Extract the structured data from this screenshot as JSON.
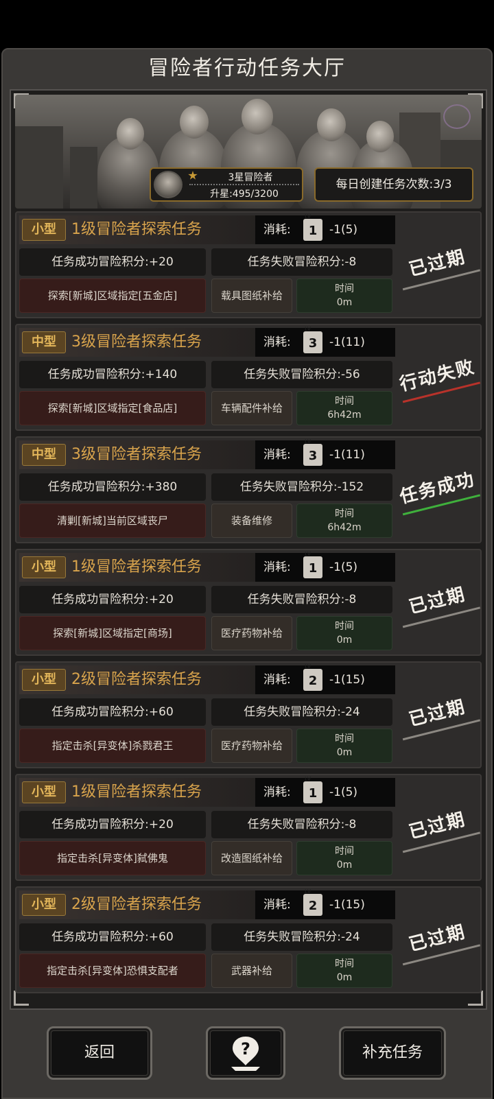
{
  "header": {
    "title": "冒险者行动任务大厅"
  },
  "rank": {
    "name": "3星冒险者",
    "progress": "升星:495/3200"
  },
  "daily": {
    "text": "每日创建任务次数:3/3"
  },
  "labels": {
    "cost": "消耗:",
    "time": "时间"
  },
  "tasks": [
    {
      "size": "小型",
      "title": "1级冒险者探索任务",
      "lv": "1",
      "cost": "-1(5)",
      "success": "任务成功冒险积分:+20",
      "fail": "任务失败冒险积分:-8",
      "target": "探索[新城]区域指定[五金店]",
      "reward": "载具图纸补给",
      "time": "0m",
      "status": "已过期",
      "status_type": "expired"
    },
    {
      "size": "中型",
      "title": "3级冒险者探索任务",
      "lv": "3",
      "cost": "-1(11)",
      "success": "任务成功冒险积分:+140",
      "fail": "任务失败冒险积分:-56",
      "target": "探索[新城]区域指定[食品店]",
      "reward": "车辆配件补给",
      "time": "6h42m",
      "status": "行动失败",
      "status_type": "fail"
    },
    {
      "size": "中型",
      "title": "3级冒险者探索任务",
      "lv": "3",
      "cost": "-1(11)",
      "success": "任务成功冒险积分:+380",
      "fail": "任务失败冒险积分:-152",
      "target": "清剿[新城]当前区域丧尸",
      "reward": "装备维修",
      "time": "6h42m",
      "status": "任务成功",
      "status_type": "success"
    },
    {
      "size": "小型",
      "title": "1级冒险者探索任务",
      "lv": "1",
      "cost": "-1(5)",
      "success": "任务成功冒险积分:+20",
      "fail": "任务失败冒险积分:-8",
      "target": "探索[新城]区域指定[商场]",
      "reward": "医疗药物补给",
      "time": "0m",
      "status": "已过期",
      "status_type": "expired"
    },
    {
      "size": "小型",
      "title": "2级冒险者探索任务",
      "lv": "2",
      "cost": "-1(15)",
      "success": "任务成功冒险积分:+60",
      "fail": "任务失败冒险积分:-24",
      "target": "指定击杀[异变体]杀戮君王",
      "reward": "医疗药物补给",
      "time": "0m",
      "status": "已过期",
      "status_type": "expired"
    },
    {
      "size": "小型",
      "title": "1级冒险者探索任务",
      "lv": "1",
      "cost": "-1(5)",
      "success": "任务成功冒险积分:+20",
      "fail": "任务失败冒险积分:-8",
      "target": "指定击杀[异变体]弑佛鬼",
      "reward": "改造图纸补给",
      "time": "0m",
      "status": "已过期",
      "status_type": "expired"
    },
    {
      "size": "小型",
      "title": "2级冒险者探索任务",
      "lv": "2",
      "cost": "-1(15)",
      "success": "任务成功冒险积分:+60",
      "fail": "任务失败冒险积分:-24",
      "target": "指定击杀[异变体]恐惧支配者",
      "reward": "武器补给",
      "time": "0m",
      "status": "已过期",
      "status_type": "expired"
    }
  ],
  "buttons": {
    "back": "返回",
    "help": "?",
    "add": "补充任务"
  },
  "icons": {
    "help": "question-pin-icon",
    "rank_star": "star-icon",
    "cost": "level-card-icon"
  },
  "colors": {
    "title_gold": "#d9a44c",
    "badge_bg": "#5b4422",
    "fail_red": "#b8322a",
    "success_green": "#3fb03c"
  }
}
